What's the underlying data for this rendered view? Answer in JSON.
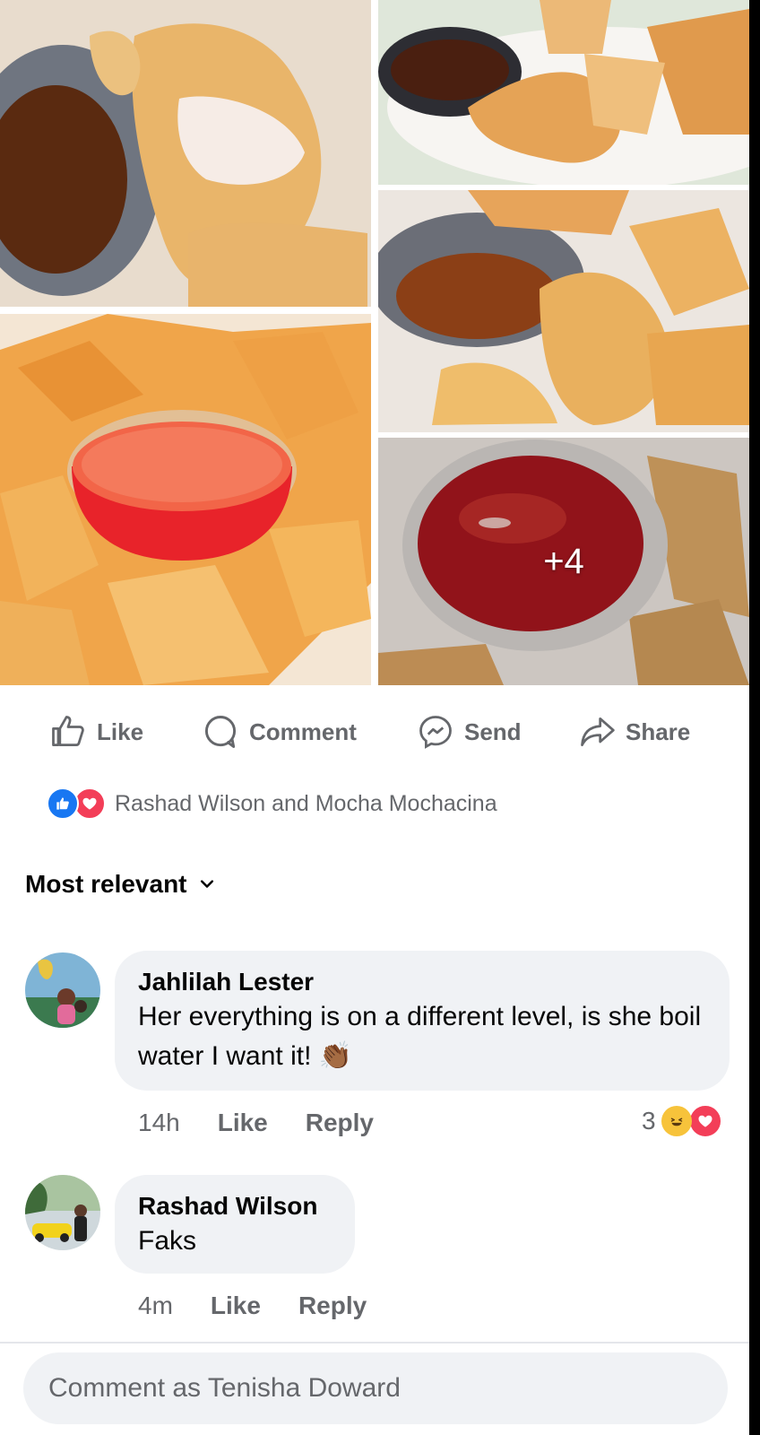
{
  "photos": {
    "more_count": "+4",
    "items": [
      "wonton-dumpling-photo",
      "wonton-platter-photo",
      "wonton-plate-photo",
      "wonton-bowl-photo",
      "sweet-chili-sauce-photo"
    ]
  },
  "actions": {
    "like": "Like",
    "comment": "Comment",
    "send": "Send",
    "share": "Share"
  },
  "reactions": {
    "names": "Rashad Wilson and Mocha Mochacina",
    "types": [
      "like",
      "love"
    ]
  },
  "sort": {
    "label": "Most relevant"
  },
  "comments": [
    {
      "author": "Jahlilah Lester",
      "text": "Her everything is on a different level, is she boil water I want it! 👏🏾",
      "time": "14h",
      "like": "Like",
      "reply": "Reply",
      "reaction_count": "3",
      "reaction_types": [
        "haha",
        "love"
      ]
    },
    {
      "author": "Rashad Wilson",
      "text": "Faks",
      "time": "4m",
      "like": "Like",
      "reply": "Reply"
    }
  ],
  "composer": {
    "placeholder": "Comment as Tenisha Doward"
  },
  "colors": {
    "secondary_text": "#65676b",
    "primary_text": "#050505",
    "bubble_bg": "#f0f2f5",
    "like_blue": "#1877f2",
    "love_red": "#f33e58"
  }
}
